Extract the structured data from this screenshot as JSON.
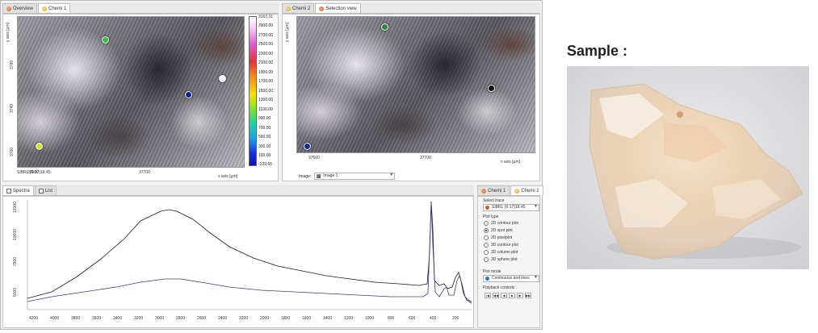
{
  "top_left_tabs": [
    {
      "label": "Overview",
      "active": false
    },
    {
      "label": "Chemi 1",
      "active": true
    }
  ],
  "top_right_tabs": [
    {
      "label": "Chemi 2",
      "active": false
    },
    {
      "label": "Selection view",
      "active": true
    }
  ],
  "map_left": {
    "y_axis_label": "y axis [µm]",
    "y_ticks": [
      "3780",
      "3740",
      "3700"
    ],
    "x_ticks": [
      "37600",
      "37700"
    ],
    "x_axis_label": "x axis [µm]",
    "corner_label": "SIBRL (6-17)18.45"
  },
  "color_scale": {
    "ticks": [
      "3167.31",
      "2900.00",
      "2700.00",
      "2500.00",
      "2300.00",
      "2100.00",
      "1900.00",
      "1700.00",
      "1500.00",
      "1300.00",
      "1100.00",
      "900.00",
      "700.00",
      "500.00",
      "300.00",
      "100.00",
      "-109.66"
    ],
    "colors": [
      "#ffffff",
      "#e05fd6",
      "#e8303a",
      "#f08a20",
      "#f7e000",
      "#7ee62a",
      "#20d0a0",
      "#1da0f0",
      "#1530e0",
      "#1010a0"
    ]
  },
  "map_right": {
    "y_axis_label": "y axis [µm]",
    "x_ticks": [
      "37600",
      "37700"
    ],
    "x_axis_label": "x axis [µm]",
    "image_label": "Image:",
    "image_value": "Image 1"
  },
  "bottom_tabs": [
    {
      "label": "Spectra",
      "active": true
    },
    {
      "label": "List",
      "active": false
    }
  ],
  "spectra": {
    "x_ticks": [
      "4200",
      "4000",
      "3800",
      "3600",
      "3400",
      "3200",
      "3000",
      "2800",
      "2600",
      "2400",
      "2200",
      "2000",
      "1800",
      "1600",
      "1400",
      "1200",
      "1000",
      "800",
      "600",
      "400",
      "200"
    ],
    "y_ticks": [
      "12000",
      "10000",
      "7500",
      "5000"
    ]
  },
  "controls": {
    "tabs": [
      {
        "label": "Chemi 1",
        "active": false
      },
      {
        "label": "Chemi 2",
        "active": true
      }
    ],
    "select_trace_label": "Select trace",
    "select_trace_value": "SIBRL (6-17)18.45",
    "plot_type_label": "Plot type",
    "plot_types": [
      {
        "label": "2D contour plot",
        "selected": false
      },
      {
        "label": "2D spot plot",
        "selected": true
      },
      {
        "label": "2D pixelplot",
        "selected": false
      },
      {
        "label": "3D contour plot",
        "selected": false
      },
      {
        "label": "3D column plot",
        "selected": false
      },
      {
        "label": "3D sphere plot",
        "selected": false
      }
    ],
    "plot_mode_label": "Plot mode",
    "plot_mode_value": "Continuous and lines",
    "playback_label": "Playback controls",
    "playback_buttons": [
      "|◀",
      "◀◀",
      "◀",
      "■",
      "▶",
      "▶▶"
    ]
  },
  "sample": {
    "title": "Sample :"
  }
}
